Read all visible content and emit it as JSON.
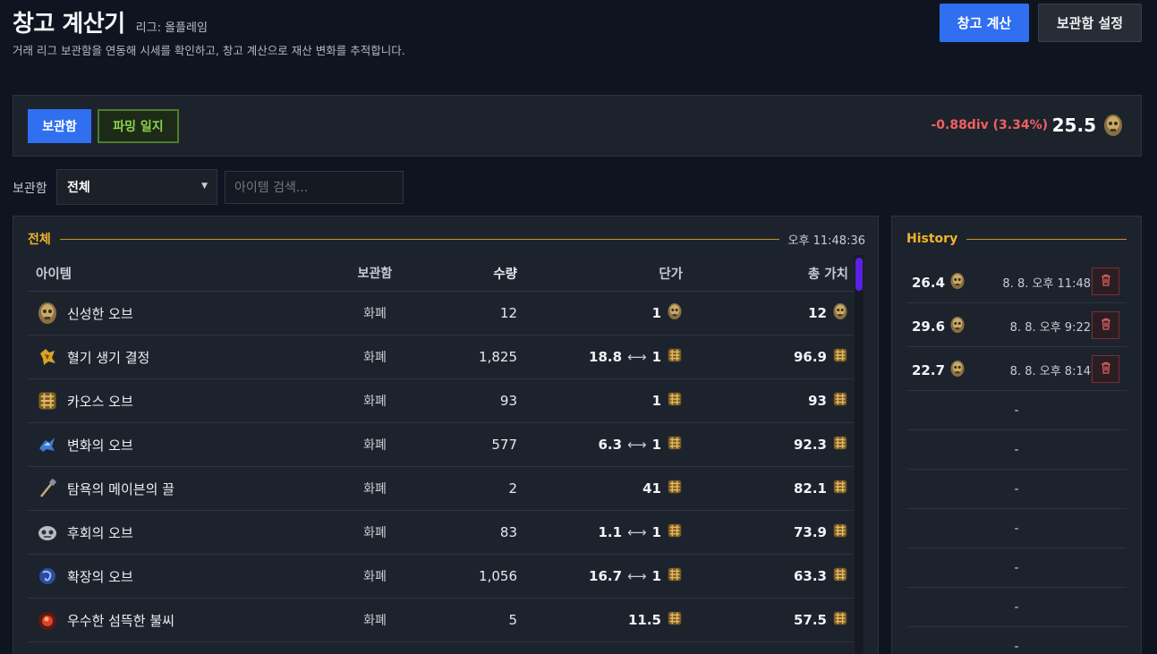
{
  "header": {
    "title": "창고 계산기",
    "league": "리그: 올플레임",
    "subtitle": "거래 리그 보관함을 연동해 시세를 확인하고, 창고 계산으로 재산 변화를 추적합니다.",
    "calc_button": "창고 계산",
    "settings_button": "보관함 설정"
  },
  "summary": {
    "tab_stash": "보관함",
    "tab_farming": "파밍 일지",
    "delta": "-0.88div (3.34%)",
    "total": "25.5",
    "colors": {
      "accent": "#2f6ff0",
      "negative": "#f06060",
      "farm": "#8bd04a",
      "gold": "#f0b429"
    }
  },
  "filter": {
    "label": "보관함",
    "selected": "전체",
    "search_placeholder": "아이템 검색..."
  },
  "table": {
    "section_title": "전체",
    "timestamp": "오후 11:48:36",
    "columns": {
      "item": "아이템",
      "stash": "보관함",
      "qty": "수량",
      "unit": "단가",
      "total": "총 가치"
    },
    "rows": [
      {
        "icon": "divine-orb-icon",
        "name": "신성한 오브",
        "stash": "화폐",
        "qty": "12",
        "unit_left": "",
        "unit": "1",
        "unit_currency": "divine",
        "total": "12",
        "total_currency": "divine"
      },
      {
        "icon": "vaal-crystal-icon",
        "name": "혈기 생기 결정",
        "stash": "화폐",
        "qty": "1,825",
        "unit_left": "18.8",
        "unit": "1",
        "unit_currency": "chaos",
        "total": "96.9",
        "total_currency": "chaos"
      },
      {
        "icon": "chaos-orb-icon",
        "name": "카오스 오브",
        "stash": "화폐",
        "qty": "93",
        "unit_left": "",
        "unit": "1",
        "unit_currency": "chaos",
        "total": "93",
        "total_currency": "chaos"
      },
      {
        "icon": "alteration-orb-icon",
        "name": "변화의 오브",
        "stash": "화폐",
        "qty": "577",
        "unit_left": "6.3",
        "unit": "1",
        "unit_currency": "chaos",
        "total": "92.3",
        "total_currency": "chaos"
      },
      {
        "icon": "chisel-icon",
        "name": "탐욕의 메이븐의 끌",
        "stash": "화폐",
        "qty": "2",
        "unit_left": "",
        "unit": "41",
        "unit_currency": "chaos",
        "total": "82.1",
        "total_currency": "chaos"
      },
      {
        "icon": "regret-orb-icon",
        "name": "후회의 오브",
        "stash": "화폐",
        "qty": "83",
        "unit_left": "1.1",
        "unit": "1",
        "unit_currency": "chaos",
        "total": "73.9",
        "total_currency": "chaos"
      },
      {
        "icon": "augment-orb-icon",
        "name": "확장의 오브",
        "stash": "화폐",
        "qty": "1,056",
        "unit_left": "16.7",
        "unit": "1",
        "unit_currency": "chaos",
        "total": "63.3",
        "total_currency": "chaos"
      },
      {
        "icon": "ember-icon",
        "name": "우수한 섬뜩한 불씨",
        "stash": "화폐",
        "qty": "5",
        "unit_left": "",
        "unit": "11.5",
        "unit_currency": "chaos",
        "total": "57.5",
        "total_currency": "chaos"
      }
    ]
  },
  "history": {
    "title": "History",
    "entries": [
      {
        "value": "26.4",
        "date": "8. 8. 오후 11:48"
      },
      {
        "value": "29.6",
        "date": "8. 8. 오후 9:22"
      },
      {
        "value": "22.7",
        "date": "8. 8. 오후 8:14"
      }
    ],
    "empty_placeholder": "-"
  }
}
